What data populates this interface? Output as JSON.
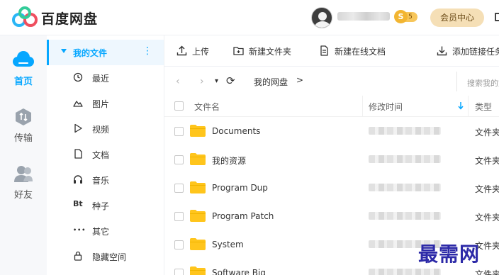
{
  "app": {
    "brand": "百度网盘"
  },
  "header": {
    "vip_label": "会员中心",
    "coin_symbol": "S",
    "coin_level": "5"
  },
  "rail": [
    {
      "label": "首页",
      "icon": "cloud-icon",
      "active": true
    },
    {
      "label": "传输",
      "icon": "transfer-icon",
      "active": false
    },
    {
      "label": "好友",
      "icon": "friends-icon",
      "active": false
    }
  ],
  "categories": {
    "header": "我的文件",
    "more": "⋮",
    "items": [
      {
        "label": "最近",
        "icon": "clock-icon"
      },
      {
        "label": "图片",
        "icon": "image-icon"
      },
      {
        "label": "视频",
        "icon": "video-icon"
      },
      {
        "label": "文档",
        "icon": "document-icon"
      },
      {
        "label": "音乐",
        "icon": "headphones-icon"
      },
      {
        "label": "种子",
        "icon": "bt-icon",
        "glyph": "Bt"
      },
      {
        "label": "其它",
        "icon": "more-dots-icon",
        "glyph": "•••"
      },
      {
        "label": "隐藏空间",
        "icon": "lock-icon"
      }
    ]
  },
  "toolbar": {
    "upload": "上传",
    "new_folder": "新建文件夹",
    "new_online_doc": "新建在线文档",
    "add_link_task": "添加链接任务"
  },
  "breadcrumb": {
    "back": "‹",
    "forward": "›",
    "dropdown": "▾",
    "refresh": "⟳",
    "current": "我的网盘",
    "separator": ">",
    "search_placeholder": "搜索我的文件"
  },
  "table": {
    "columns": {
      "name": "文件名",
      "modified": "修改时间",
      "type": "类型"
    },
    "rows": [
      {
        "name": "Documents",
        "type": "文件夹"
      },
      {
        "name": "我的资源",
        "type": "文件夹"
      },
      {
        "name": "Program Dup",
        "type": "文件夹"
      },
      {
        "name": "Program Patch",
        "type": "文件夹"
      },
      {
        "name": "System",
        "type": "文件夹"
      },
      {
        "name": "Software Big",
        "type": "文件夹"
      }
    ]
  },
  "watermark": "最需网",
  "colors": {
    "accent": "#06a7ff",
    "folder": "#ffc51c",
    "vip_bg": "#f5dfb6"
  }
}
